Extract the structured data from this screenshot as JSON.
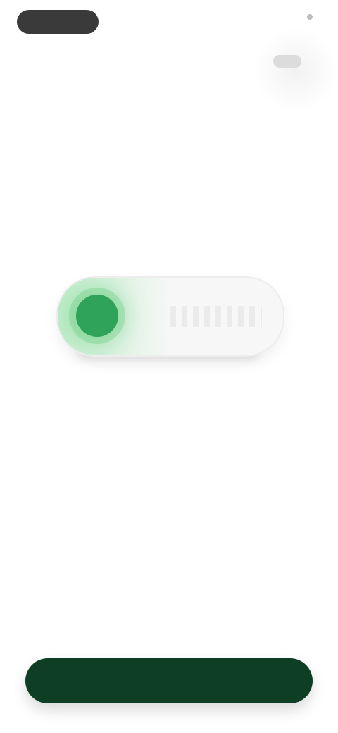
{
  "status_bar": {
    "left_label": "",
    "right_label": "",
    "badge_label": ""
  },
  "toggle": {
    "state": "on",
    "accent_color": "#2fa35a"
  },
  "caption": {
    "line1": "",
    "line2": ""
  },
  "primary_action": {
    "label": "",
    "color": "#0e3f24"
  }
}
